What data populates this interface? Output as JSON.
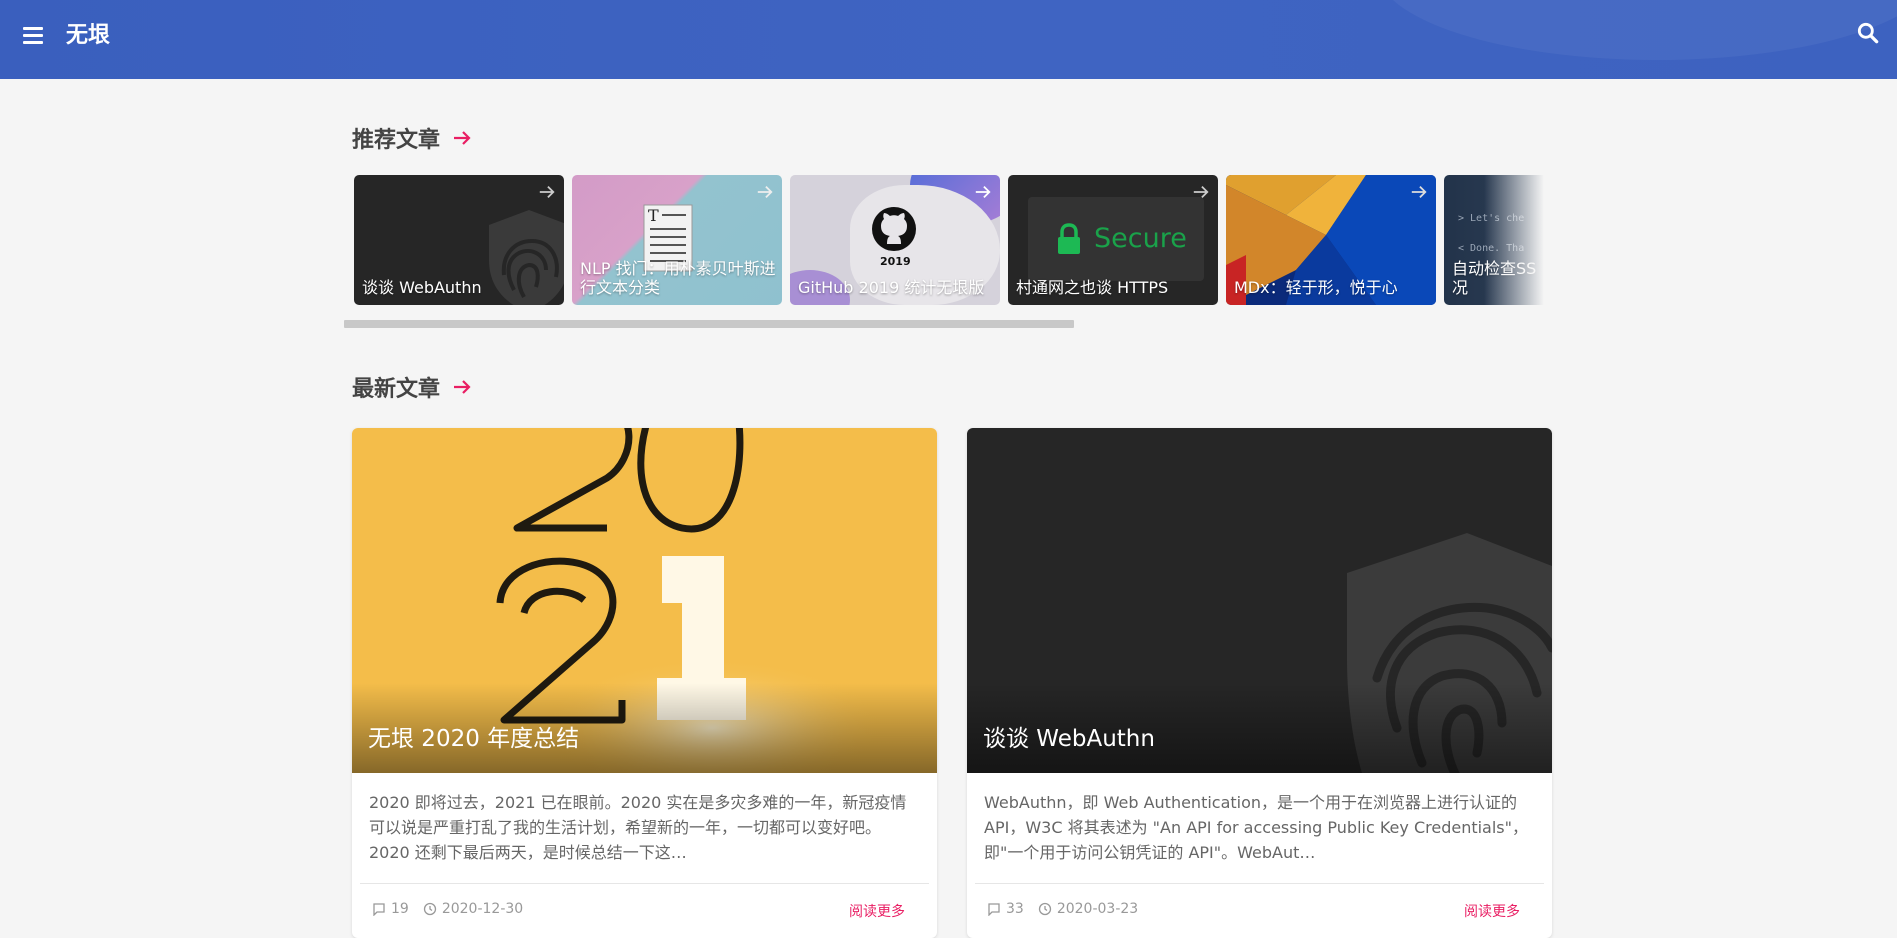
{
  "header": {
    "title": "无垠"
  },
  "recommended": {
    "title": "推荐文章",
    "items": [
      {
        "title": "谈谈 WebAuthn"
      },
      {
        "title": "NLP 找门：用朴素贝叶斯进行文本分类"
      },
      {
        "title": "GitHub 2019 统计无垠版",
        "badge": "2019"
      },
      {
        "title": "村通网之也谈 HTTPS",
        "badge": "Secure"
      },
      {
        "title": "MDx：轻于形，悦于心"
      },
      {
        "title": "自动检查SS况",
        "code_lines": [
          "> Let's che",
          "< Done. Tha"
        ]
      }
    ]
  },
  "latest": {
    "title": "最新文章",
    "posts": [
      {
        "title": "无垠 2020 年度总结",
        "excerpt": "2020 即将过去，2021 已在眼前。2020 实在是多灾多难的一年，新冠疫情可以说是严重打乱了我的生活计划，希望新的一年，一切都可以变好吧。 2020 还剩下最后两天，是时候总结一下这…",
        "comments": "19",
        "date": "2020-12-30",
        "read_more": "阅读更多"
      },
      {
        "title": "谈谈 WebAuthn",
        "excerpt": "WebAuthn，即 Web Authentication，是一个用于在浏览器上进行认证的 API，W3C 将其表述为 \"An API for accessing Public Key Credentials\"，即\"一个用于访问公钥凭证的 API\"。WebAut…",
        "comments": "33",
        "date": "2020-03-23",
        "read_more": "阅读更多"
      }
    ]
  },
  "colors": {
    "header": "#3d62c0",
    "accent": "#e91e63",
    "background": "#f5f5f5"
  }
}
